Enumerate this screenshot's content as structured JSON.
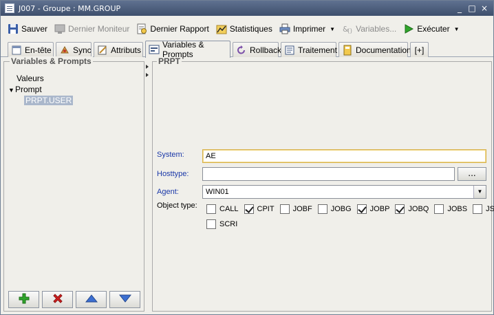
{
  "window": {
    "title": "J007 - Groupe : MM.GROUP",
    "controls": [
      "_",
      "□",
      "×"
    ]
  },
  "toolbar": {
    "save": "Sauver",
    "last_monitor": "Dernier Moniteur",
    "last_report": "Dernier Rapport",
    "statistics": "Statistiques",
    "print": "Imprimer",
    "variables": "Variables...",
    "execute": "Exécuter"
  },
  "tabs": [
    "En-tête",
    "Sync",
    "Attributs",
    "Variables & Prompts",
    "Rollback",
    "Traitement",
    "Documentation",
    "[+]"
  ],
  "active_tab": "Variables & Prompts",
  "left_panel": {
    "title": "Variables & Prompts",
    "tree": {
      "valeurs": "Valeurs",
      "prompt": "Prompt",
      "prpt_user": "PRPT.USER"
    }
  },
  "right_panel": {
    "title": "PRPT",
    "system_label": "System:",
    "system_value": "AE",
    "hosttype_label": "Hosttype:",
    "hosttype_value": "",
    "ellipsis": "...",
    "agent_label": "Agent:",
    "agent_value": "WIN01",
    "object_type_label": "Object type:",
    "object_types": [
      {
        "label": "CALL",
        "checked": false
      },
      {
        "label": "CPIT",
        "checked": true
      },
      {
        "label": "JOBF",
        "checked": false
      },
      {
        "label": "JOBG",
        "checked": false
      },
      {
        "label": "JOBP",
        "checked": true
      },
      {
        "label": "JOBQ",
        "checked": true
      },
      {
        "label": "JOBS",
        "checked": false
      },
      {
        "label": "JSCH",
        "checked": false
      },
      {
        "label": "SCRI",
        "checked": false
      }
    ]
  },
  "colors": {
    "title_bar": "#4a5a7a",
    "label_blue": "#1a38a8",
    "add_green": "#2fa52b",
    "delete_red": "#d32020",
    "arrow_blue": "#3c6fd1"
  }
}
